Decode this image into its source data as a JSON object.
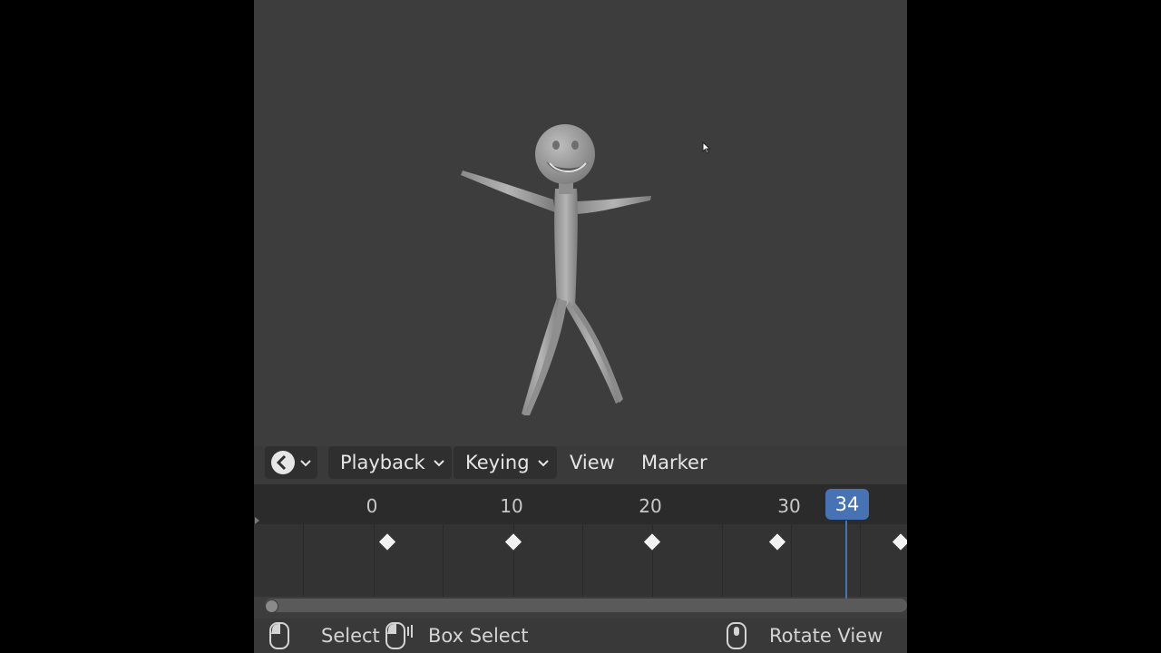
{
  "menu": {
    "editor_type_icon": "clock-icon",
    "playback_label": "Playback",
    "keying_label": "Keying",
    "view_label": "View",
    "marker_label": "Marker"
  },
  "timeline": {
    "frame_labels": [
      "0",
      "10",
      "20",
      "30"
    ],
    "current_frame": "34",
    "accent_color": "#4772b3"
  },
  "status_bar": {
    "select_label": "Select",
    "box_select_label": "Box Select",
    "rotate_view_label": "Rotate View"
  }
}
